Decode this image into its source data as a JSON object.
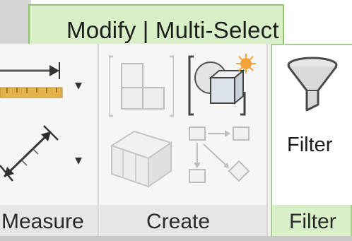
{
  "context_tab": {
    "label": "Modify | Multi-Select"
  },
  "panels": {
    "measure": {
      "footer_label": "Measure"
    },
    "create": {
      "footer_label": "Create"
    },
    "filter": {
      "footer_label": "Filter",
      "button_label": "Filter"
    }
  },
  "icons": {
    "measure_between_refs": "measure-between-references-icon",
    "measure_along_element": "measure-along-element-icon",
    "create_group": "create-group-icon",
    "create_similar": "create-similar-icon",
    "create_parts": "create-parts-icon",
    "create_assembly": "create-assembly-icon",
    "filter": "funnel-icon"
  },
  "colors": {
    "context_tab_bg": "#d9efc8",
    "context_tab_border": "#8fc36f",
    "ribbon_bg": "#f2f2f2"
  }
}
